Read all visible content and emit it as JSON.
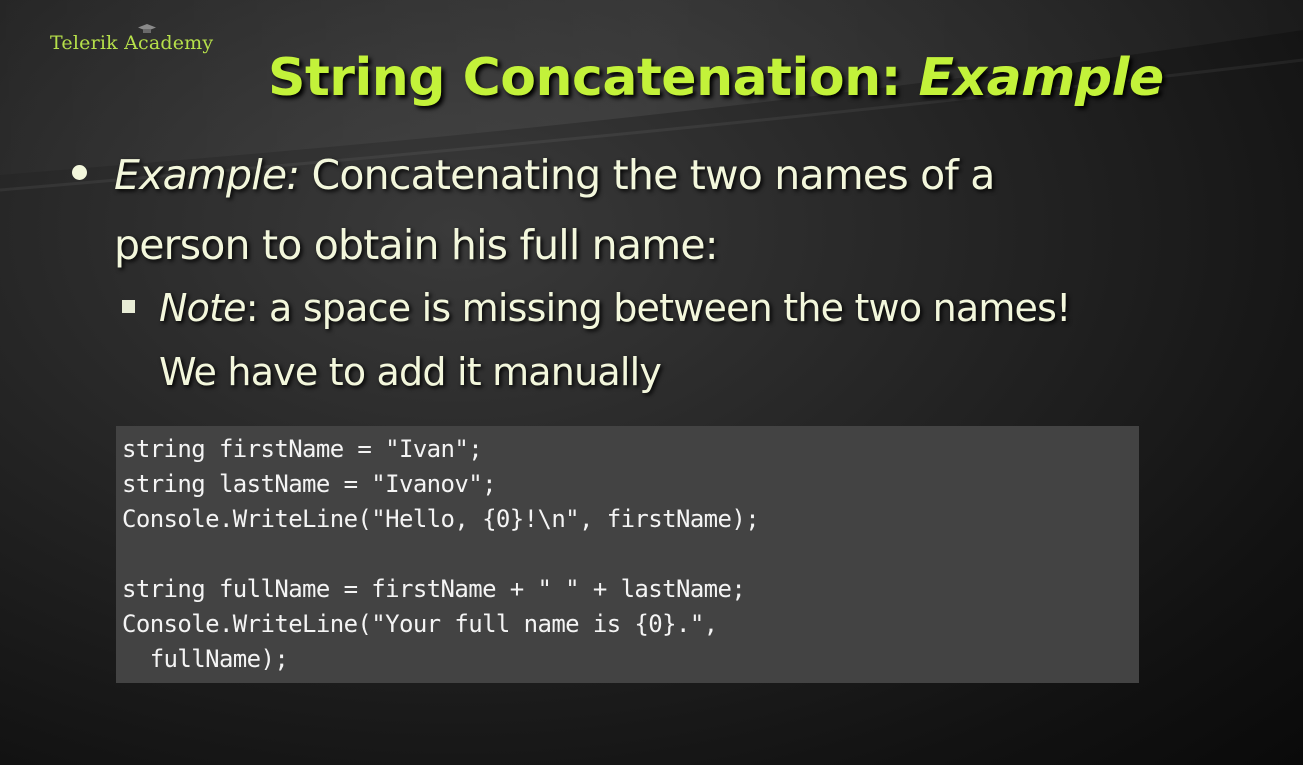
{
  "logo": {
    "text": "Telerik Academy"
  },
  "slide": {
    "title": {
      "main": "String Concatenation: ",
      "emphasis": "Example"
    },
    "bullet1": {
      "lead": "Example:",
      "line1_rest": " Concatenating the two names of a",
      "line2": "person to obtain his full name:"
    },
    "bullet2": {
      "lead": "Note",
      "line1_rest": ": a space is missing between the two names!",
      "line2": "We have to add it manually"
    },
    "code": {
      "lines": [
        "string firstName = \"Ivan\";",
        "string lastName = \"Ivanov\";",
        "Console.WriteLine(\"Hello, {0}!\\n\", firstName);",
        "",
        "string fullName = firstName + \" \" + lastName;",
        "Console.WriteLine(\"Your full name is {0}.\",",
        "  fullName);"
      ]
    }
  },
  "colors": {
    "title": "#c3f23a",
    "body_text": "#f3f7dc",
    "logo": "#b6e04a",
    "code_bg": "#434343",
    "code_text": "#f4f4f4"
  },
  "icons": {
    "logo_cap": "graduation-cap-icon",
    "bullet1": "round-bullet-icon",
    "bullet2": "square-bullet-icon"
  }
}
